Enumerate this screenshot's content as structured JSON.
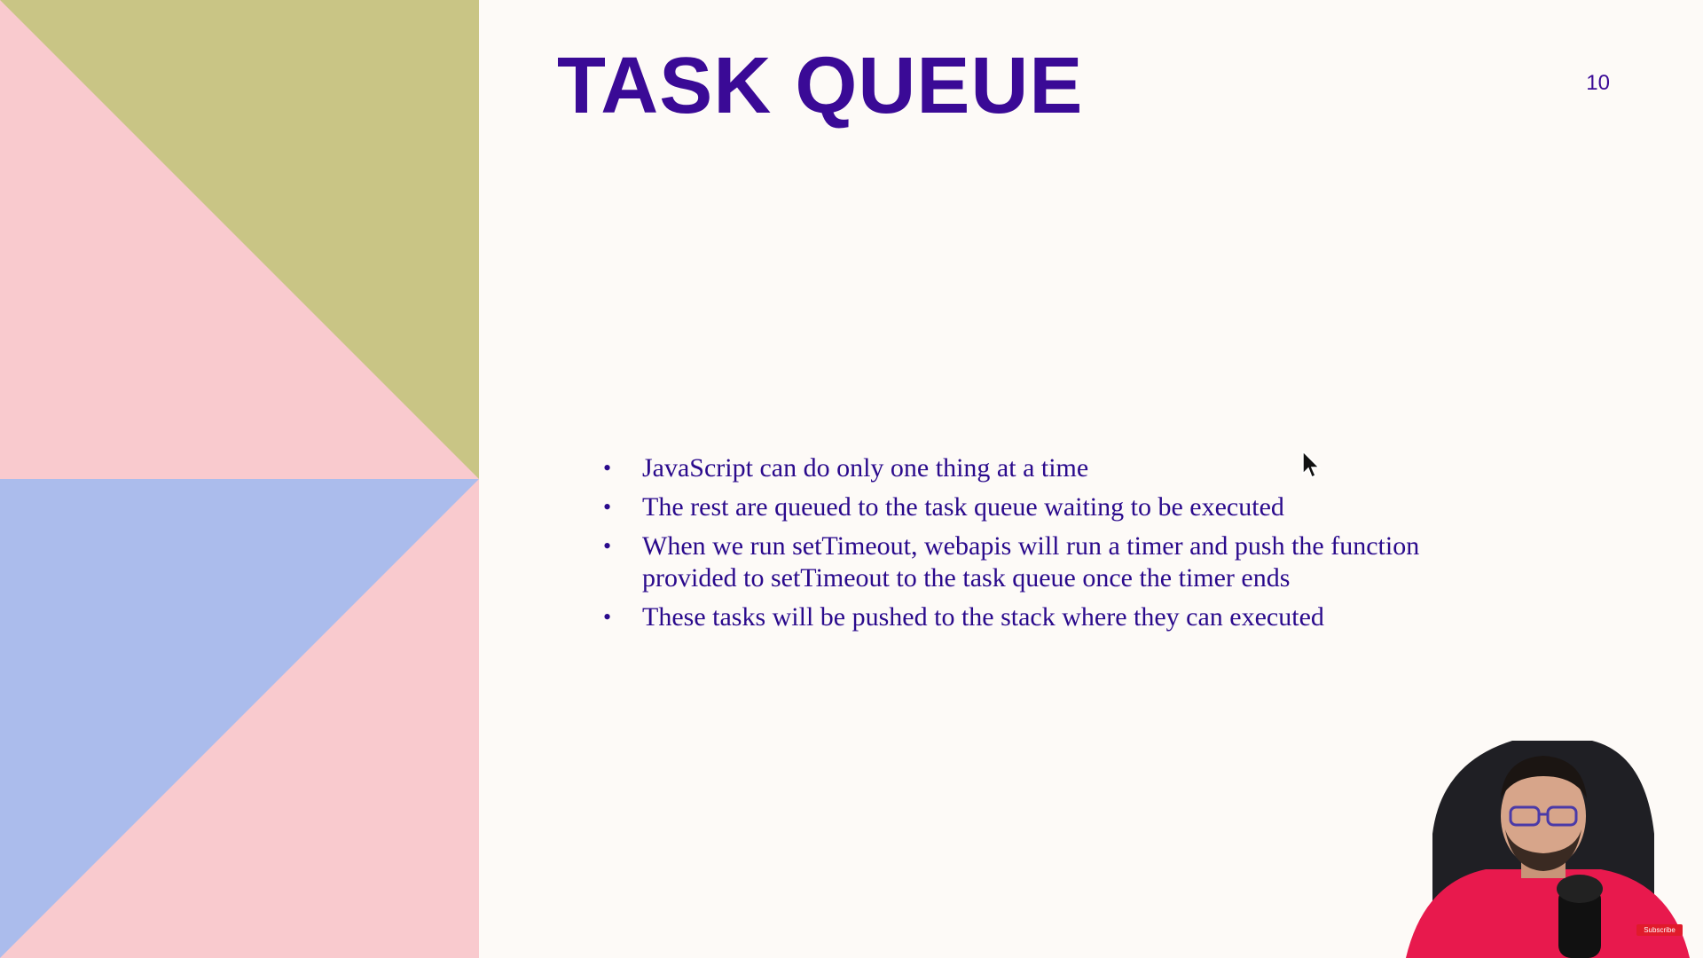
{
  "slide": {
    "title": "TASK QUEUE",
    "page_number": "10",
    "bullets": [
      "JavaScript can do only one thing at a time",
      "The rest are queued to the task queue waiting to be executed",
      "When we run setTimeout, webapis will run a timer and push the function provided to setTimeout to the task queue once the timer ends",
      "These tasks will be pushed to the stack where they can executed"
    ],
    "bullet_symbol": "•"
  },
  "overlay": {
    "subscribe_label": "Subscribe"
  },
  "colors": {
    "background": "#fdfaf7",
    "title": "#3a0a96",
    "text": "#2a0a8c",
    "panel_pink": "#f9cace",
    "panel_olive": "#c9c585",
    "panel_blue": "#abbcec"
  },
  "icons": {
    "cursor": "mouse-pointer-icon",
    "subscribe": "youtube-subscribe-icon"
  }
}
